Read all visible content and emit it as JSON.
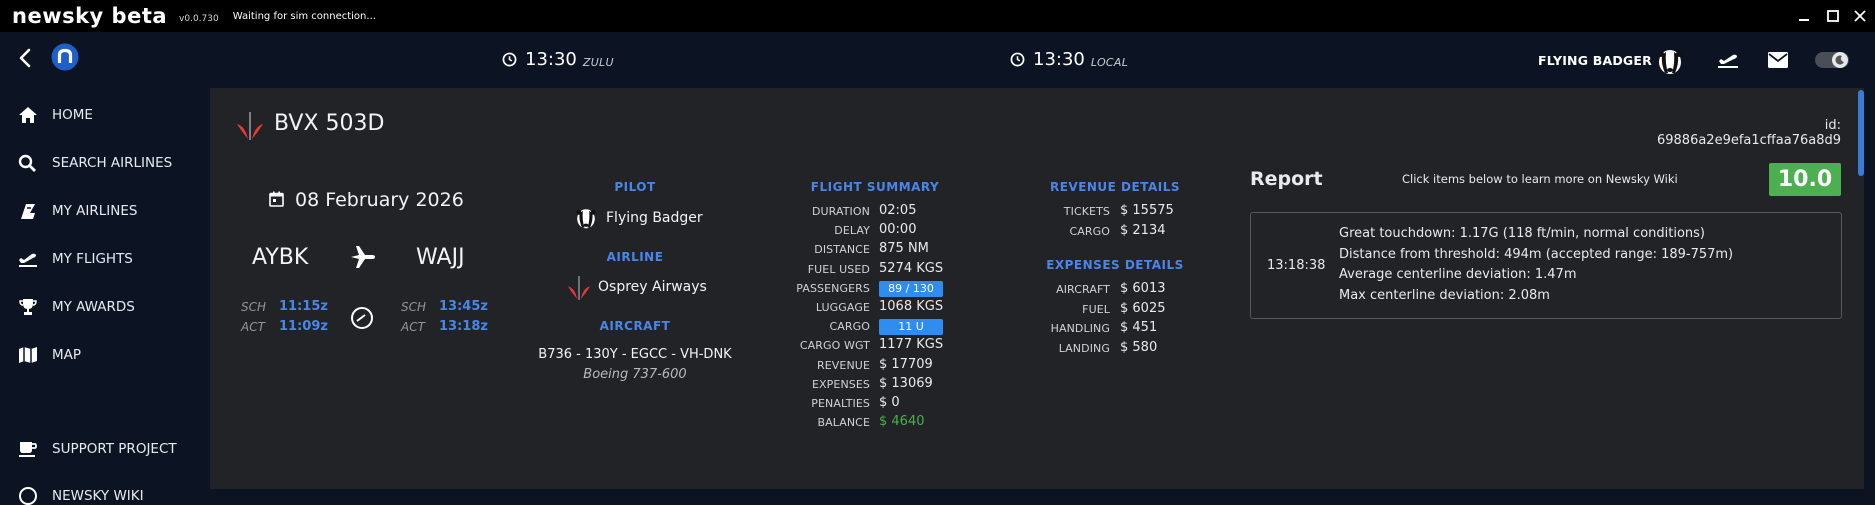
{
  "app": {
    "name": "newsky beta",
    "version": "v0.0.730",
    "status": "Waiting for sim connection..."
  },
  "header": {
    "zulu_time": "13:30",
    "zulu_label": "ZULU",
    "local_time": "13:30",
    "local_label": "LOCAL",
    "user_name": "FLYING BADGER"
  },
  "sidebar": {
    "items": [
      {
        "label": "HOME",
        "icon": "home-icon"
      },
      {
        "label": "SEARCH AIRLINES",
        "icon": "search-icon"
      },
      {
        "label": "MY AIRLINES",
        "icon": "airline-tail-icon"
      },
      {
        "label": "MY FLIGHTS",
        "icon": "plane-takeoff-icon"
      },
      {
        "label": "MY AWARDS",
        "icon": "trophy-icon"
      },
      {
        "label": "MAP",
        "icon": "map-icon"
      },
      {
        "label": "SUPPORT PROJECT",
        "icon": "coffee-icon"
      },
      {
        "label": "NEWSKY WIKI",
        "icon": "wiki-icon"
      }
    ]
  },
  "flight": {
    "callsign": "BVX 503D",
    "id_text": "id: 69886a2e9efa1cffaa76a8d9",
    "date": "08 February 2026",
    "departure": "AYBK",
    "arrival": "WAJJ",
    "dep_sch_label": "SCH",
    "dep_sch": "11:15z",
    "dep_act_label": "ACT",
    "dep_act": "11:09z",
    "arr_sch_label": "SCH",
    "arr_sch": "13:45z",
    "arr_act_label": "ACT",
    "arr_act": "13:18z"
  },
  "pilot": {
    "heading": "PILOT",
    "name": "Flying Badger",
    "airline_heading": "AIRLINE",
    "airline_name": "Osprey Airways",
    "aircraft_heading": "AIRCRAFT",
    "aircraft_line": "B736 - 130Y - EGCC - VH-DNK",
    "aircraft_model": "Boeing 737-600"
  },
  "summary": {
    "heading": "FLIGHT SUMMARY",
    "rows": [
      {
        "label": "DURATION",
        "value": "02:05"
      },
      {
        "label": "DELAY",
        "value": "00:00"
      },
      {
        "label": "DISTANCE",
        "value": "875 NM"
      },
      {
        "label": "FUEL USED",
        "value": "5274 KGS"
      },
      {
        "label": "PASSENGERS",
        "value": "89 / 130"
      },
      {
        "label": "LUGGAGE",
        "value": "1068 KGS"
      },
      {
        "label": "CARGO",
        "value": "11 U"
      },
      {
        "label": "CARGO WGT",
        "value": "1177 KGS"
      },
      {
        "label": "REVENUE",
        "value": "$ 17709"
      },
      {
        "label": "EXPENSES",
        "value": "$ 13069"
      },
      {
        "label": "PENALTIES",
        "value": "$ 0"
      },
      {
        "label": "BALANCE",
        "value": "$ 4640"
      }
    ],
    "passenger_load": 0.685,
    "balance_color": "#4caf50",
    "badge_color": "#2f8cf0"
  },
  "revenue": {
    "heading": "REVENUE DETAILS",
    "rows": [
      {
        "label": "TICKETS",
        "value": "$ 15575"
      },
      {
        "label": "CARGO",
        "value": "$ 2134"
      }
    ]
  },
  "expenses": {
    "heading": "EXPENSES DETAILS",
    "rows": [
      {
        "label": "AIRCRAFT",
        "value": "$ 6013"
      },
      {
        "label": "FUEL",
        "value": "$ 6025"
      },
      {
        "label": "HANDLING",
        "value": "$ 451"
      },
      {
        "label": "LANDING",
        "value": "$ 580"
      }
    ]
  },
  "report": {
    "title": "Report",
    "hint": "Click items below to learn more on Newsky Wiki",
    "score": "10.0",
    "score_color": "#4caf50",
    "entry_time": "13:18:38",
    "lines": [
      "Great touchdown: 1.17G (118 ft/min, normal conditions)",
      "Distance from threshold: 494m (accepted range: 189-757m)",
      "Average centerline deviation: 1.47m",
      "Max centerline deviation: 2.08m"
    ]
  },
  "colors": {
    "accent_blue": "#4a86e8",
    "panel_bg": "#222326",
    "app_bg": "#0c1424"
  }
}
